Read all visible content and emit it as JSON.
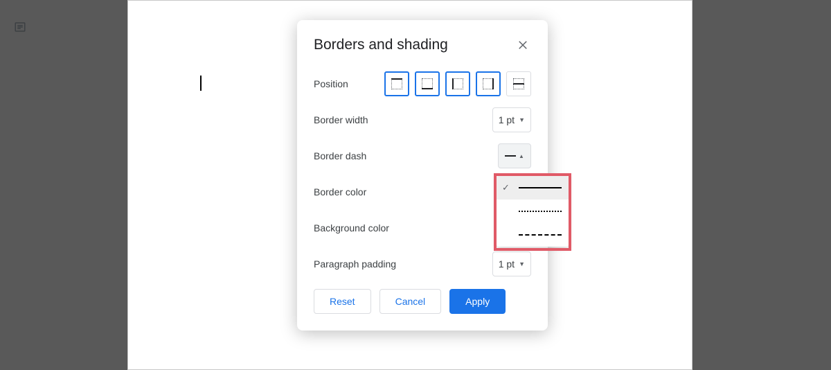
{
  "dialog": {
    "title": "Borders and shading",
    "labels": {
      "position": "Position",
      "border_width": "Border width",
      "border_dash": "Border dash",
      "border_color": "Border color",
      "background_color": "Background color",
      "paragraph_padding": "Paragraph padding"
    },
    "border_width_value": "1 pt",
    "paragraph_padding_value": "1 pt",
    "actions": {
      "reset": "Reset",
      "cancel": "Cancel",
      "apply": "Apply"
    }
  },
  "position_options": [
    {
      "id": "top",
      "selected": true
    },
    {
      "id": "bottom",
      "selected": true
    },
    {
      "id": "left",
      "selected": true
    },
    {
      "id": "right",
      "selected": true
    },
    {
      "id": "between",
      "selected": false
    }
  ],
  "dash_menu": {
    "options": [
      {
        "id": "solid",
        "selected": true
      },
      {
        "id": "dotted",
        "selected": false
      },
      {
        "id": "dashed",
        "selected": false
      }
    ]
  }
}
